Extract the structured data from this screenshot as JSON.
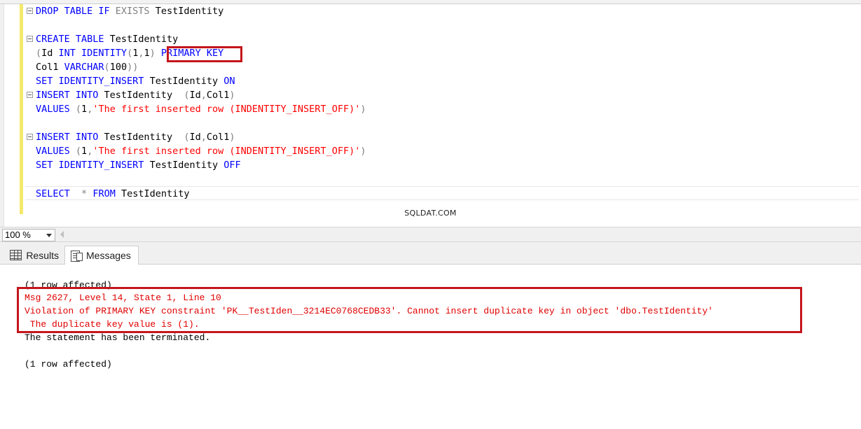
{
  "editor": {
    "lines": [
      [
        {
          "t": "DROP TABLE IF ",
          "c": "kw"
        },
        {
          "t": "EXISTS",
          "c": "gray"
        },
        {
          "t": " TestIdentity",
          "c": "txt"
        }
      ],
      [],
      [
        {
          "t": "CREATE TABLE",
          "c": "kw"
        },
        {
          "t": " TestIdentity",
          "c": "txt"
        }
      ],
      [
        {
          "t": "(",
          "c": "gray"
        },
        {
          "t": "Id ",
          "c": "txt"
        },
        {
          "t": "INT IDENTITY",
          "c": "kw"
        },
        {
          "t": "(",
          "c": "gray"
        },
        {
          "t": "1",
          "c": "txt"
        },
        {
          "t": ",",
          "c": "gray"
        },
        {
          "t": "1",
          "c": "txt"
        },
        {
          "t": ") ",
          "c": "gray"
        },
        {
          "t": "PRIMARY KEY",
          "c": "kw"
        }
      ],
      [
        {
          "t": "Col1 ",
          "c": "txt"
        },
        {
          "t": "VARCHAR",
          "c": "kw"
        },
        {
          "t": "(",
          "c": "gray"
        },
        {
          "t": "100",
          "c": "txt"
        },
        {
          "t": "))",
          "c": "gray"
        }
      ],
      [
        {
          "t": "SET IDENTITY_INSERT",
          "c": "kw"
        },
        {
          "t": " TestIdentity ",
          "c": "txt"
        },
        {
          "t": "ON",
          "c": "kw"
        }
      ],
      [
        {
          "t": "INSERT INTO",
          "c": "kw"
        },
        {
          "t": " TestIdentity  ",
          "c": "txt"
        },
        {
          "t": "(",
          "c": "gray"
        },
        {
          "t": "Id",
          "c": "txt"
        },
        {
          "t": ",",
          "c": "gray"
        },
        {
          "t": "Col1",
          "c": "txt"
        },
        {
          "t": ")",
          "c": "gray"
        }
      ],
      [
        {
          "t": "VALUES ",
          "c": "kw"
        },
        {
          "t": "(",
          "c": "gray"
        },
        {
          "t": "1",
          "c": "txt"
        },
        {
          "t": ",",
          "c": "gray"
        },
        {
          "t": "'The first inserted row (INDENTITY_INSERT_OFF)'",
          "c": "str"
        },
        {
          "t": ")",
          "c": "gray"
        }
      ],
      [],
      [
        {
          "t": "INSERT INTO",
          "c": "kw"
        },
        {
          "t": " TestIdentity  ",
          "c": "txt"
        },
        {
          "t": "(",
          "c": "gray"
        },
        {
          "t": "Id",
          "c": "txt"
        },
        {
          "t": ",",
          "c": "gray"
        },
        {
          "t": "Col1",
          "c": "txt"
        },
        {
          "t": ")",
          "c": "gray"
        }
      ],
      [
        {
          "t": "VALUES ",
          "c": "kw"
        },
        {
          "t": "(",
          "c": "gray"
        },
        {
          "t": "1",
          "c": "txt"
        },
        {
          "t": ",",
          "c": "gray"
        },
        {
          "t": "'The first inserted row (INDENTITY_INSERT_OFF)'",
          "c": "str"
        },
        {
          "t": ")",
          "c": "gray"
        }
      ],
      [
        {
          "t": "SET IDENTITY_INSERT",
          "c": "kw"
        },
        {
          "t": " TestIdentity ",
          "c": "txt"
        },
        {
          "t": "OFF",
          "c": "kw"
        }
      ],
      [],
      [
        {
          "t": "SELECT",
          "c": "kw"
        },
        {
          "t": "  ",
          "c": "txt"
        },
        {
          "t": "*",
          "c": "gray"
        },
        {
          "t": " ",
          "c": "txt"
        },
        {
          "t": "FROM",
          "c": "kw"
        },
        {
          "t": " TestIdentity",
          "c": "txt"
        }
      ]
    ]
  },
  "watermark": "SQLDAT.COM",
  "zoom": {
    "value": "100 %"
  },
  "tabs": {
    "results": "Results",
    "messages": "Messages"
  },
  "messages": {
    "line1": "(1 row affected)",
    "error1": "Msg 2627, Level 14, State 1, Line 10",
    "error2": "Violation of PRIMARY KEY constraint 'PK__TestIden__3214EC0768CEDB33'. Cannot insert duplicate key in object 'dbo.TestIdentity'",
    "error3": " The duplicate key value is (1).",
    "terminated": "The statement has been terminated.",
    "line2": "(1 row affected)"
  },
  "colors": {
    "highlight_box": "#c4161c",
    "error_text": "#e00000",
    "keyword": "#0000ff",
    "string": "#ff0000"
  }
}
